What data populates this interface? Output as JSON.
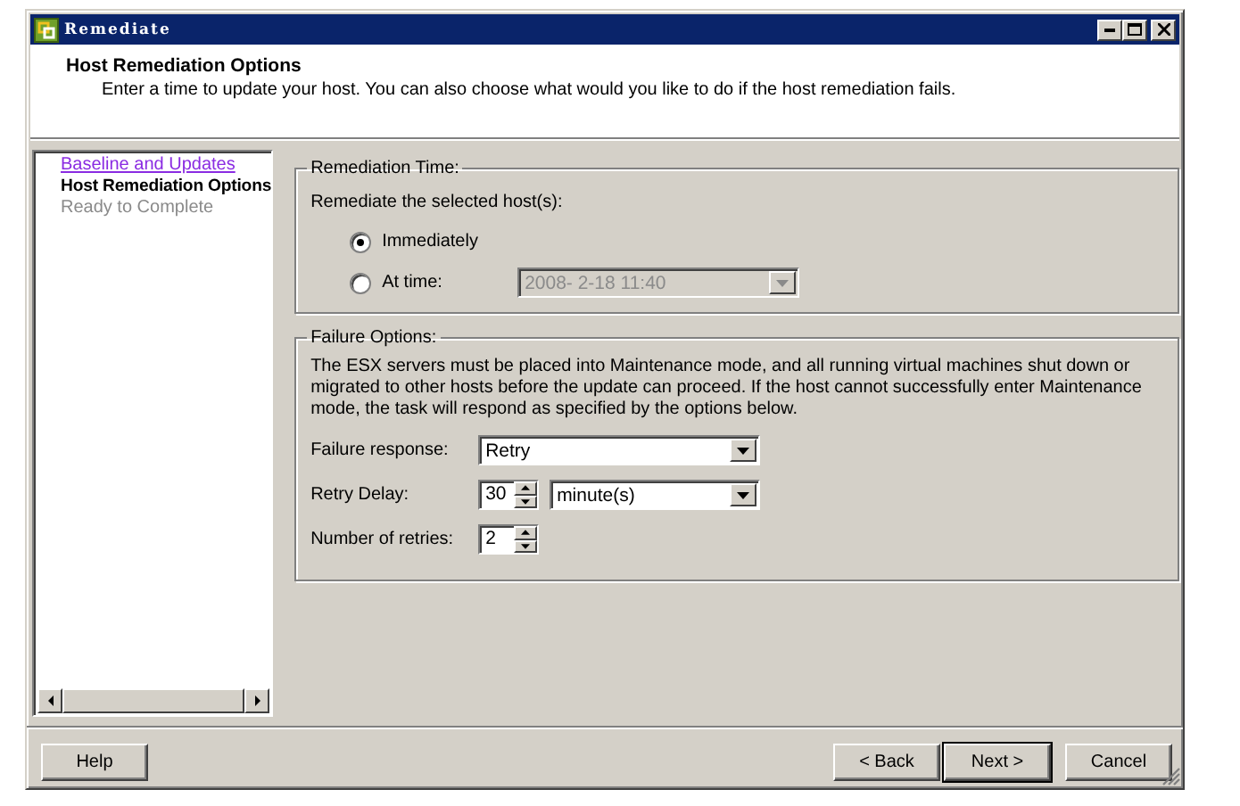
{
  "window": {
    "title": "Remediate"
  },
  "header": {
    "title": "Host Remediation Options",
    "description": "Enter a time to update your host. You can also choose what would you like to do if the host remediation fails."
  },
  "steps": [
    {
      "label": "Baseline and Updates",
      "kind": "visited",
      "selected": false
    },
    {
      "label": "Host Remediation Options",
      "kind": "current",
      "selected": true
    },
    {
      "label": "Ready to Complete",
      "kind": "pending",
      "selected": false
    }
  ],
  "remediation_time": {
    "legend": "Remediation Time:",
    "prompt": "Remediate the selected host(s):",
    "options": [
      {
        "label": "Immediately",
        "selected": true
      },
      {
        "label": "At time:",
        "selected": false
      }
    ],
    "time_field": {
      "value": "2008-  2-18 11:40",
      "disabled": true
    }
  },
  "failure_options": {
    "legend": "Failure Options:",
    "description": "The ESX servers must be placed into Maintenance mode, and all running virtual machines shut down or migrated to other hosts before the update can proceed. If the host cannot successfully enter Maintenance mode, the task will respond as specified by the options below.",
    "failure_response": {
      "label": "Failure response:",
      "value": "Retry"
    },
    "retry_delay": {
      "label": "Retry Delay:",
      "value": "30",
      "unit": "minute(s)"
    },
    "retries": {
      "label": "Number of retries:",
      "value": "2"
    }
  },
  "buttons": [
    {
      "label": "Help",
      "kind": "help",
      "default": false
    },
    {
      "label": "< Back",
      "kind": "nav",
      "default": false
    },
    {
      "label": "Next >",
      "kind": "nav",
      "default": true
    },
    {
      "label": "Cancel",
      "kind": "nav",
      "default": false
    }
  ]
}
